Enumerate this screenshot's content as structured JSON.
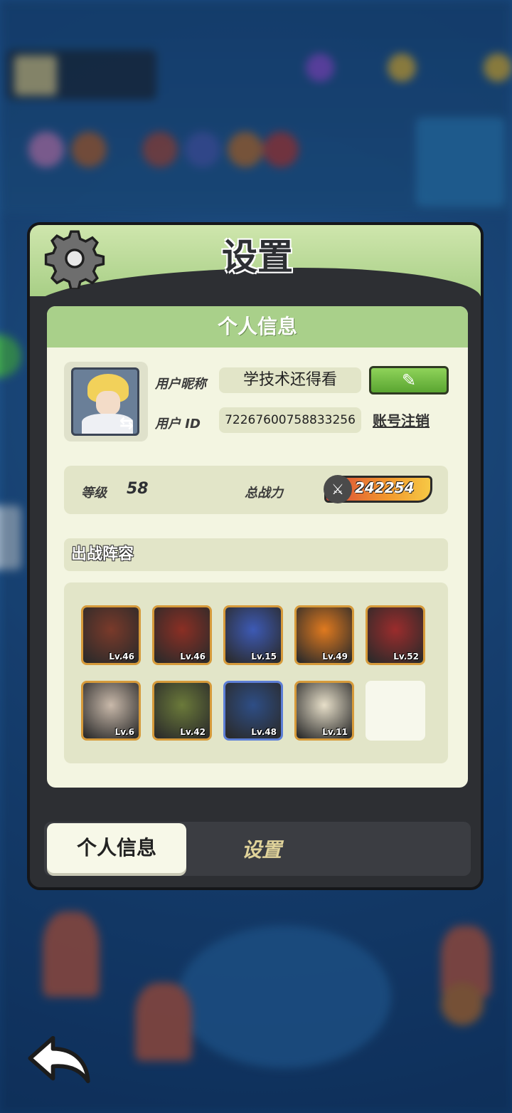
{
  "panel": {
    "title": "设置"
  },
  "info": {
    "header": "个人信息",
    "nickname_label": "用户昵称",
    "nickname_value": "学技术还得看",
    "uid_label": "用户 ID",
    "uid_value": "72267600758833256",
    "deregister": "账号注销",
    "level_label": "等级",
    "level_value": "58",
    "power_label": "总战力",
    "power_value": "242254",
    "lineup_label": "出战阵容"
  },
  "heroes": [
    {
      "level": "Lv.46",
      "color": "#7a3a2a"
    },
    {
      "level": "Lv.46",
      "color": "#8b2f24"
    },
    {
      "level": "Lv.15",
      "color": "#3d5ab5"
    },
    {
      "level": "Lv.49",
      "color": "#e07a1f"
    },
    {
      "level": "Lv.52",
      "color": "#9b2c2c"
    },
    {
      "level": "Lv.6",
      "color": "#c9b9aa"
    },
    {
      "level": "Lv.42",
      "color": "#6b7a3a"
    },
    {
      "level": "Lv.48",
      "color": "#2e4e86"
    },
    {
      "level": "Lv.11",
      "color": "#e7dfc9"
    }
  ],
  "tabs": {
    "profile": "个人信息",
    "settings": "设置"
  }
}
